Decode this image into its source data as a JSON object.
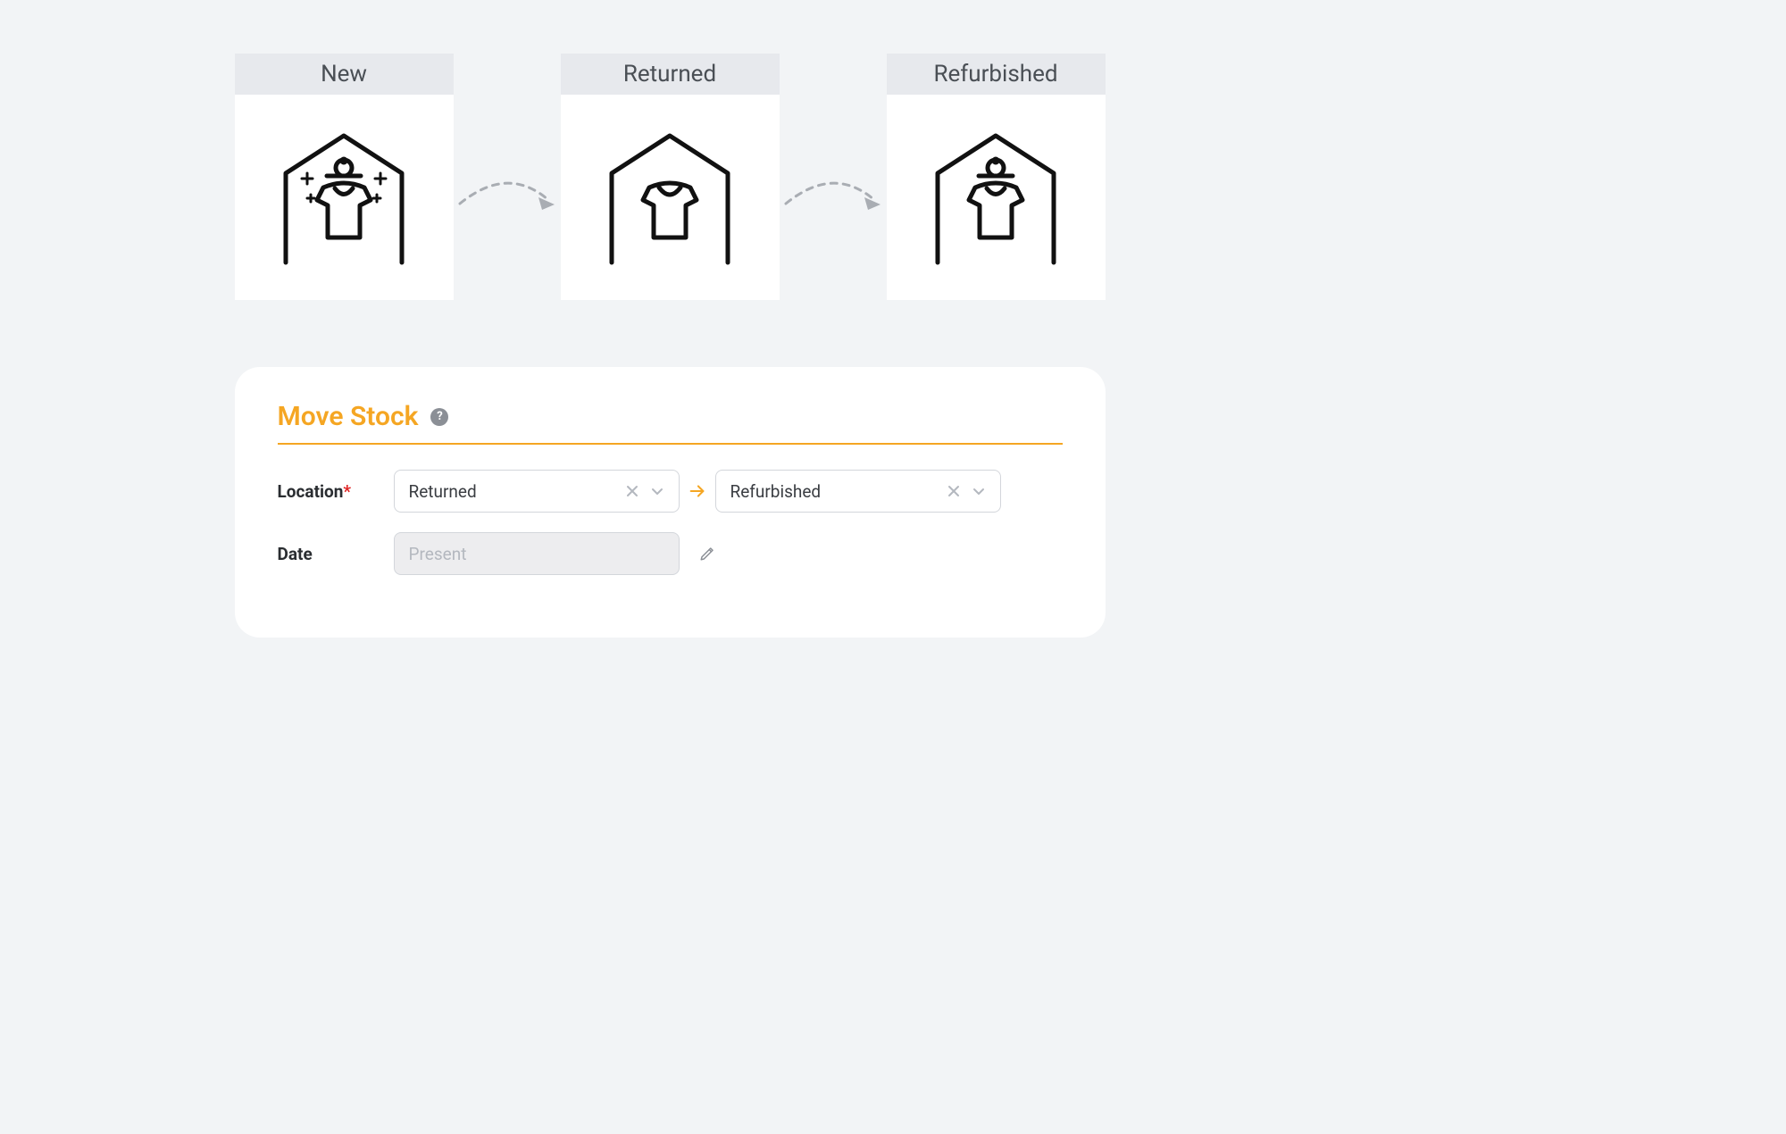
{
  "stages": [
    {
      "label": "New"
    },
    {
      "label": "Returned"
    },
    {
      "label": "Refurbished"
    }
  ],
  "panel": {
    "title": "Move Stock",
    "help_glyph": "?",
    "location_label": "Location",
    "required_mark": "*",
    "from_value": "Returned",
    "to_value": "Refurbished",
    "date_label": "Date",
    "date_placeholder": "Present"
  },
  "colors": {
    "accent": "#f5a623",
    "page_bg": "#f2f4f6",
    "label_bg": "#e7e9ed"
  }
}
